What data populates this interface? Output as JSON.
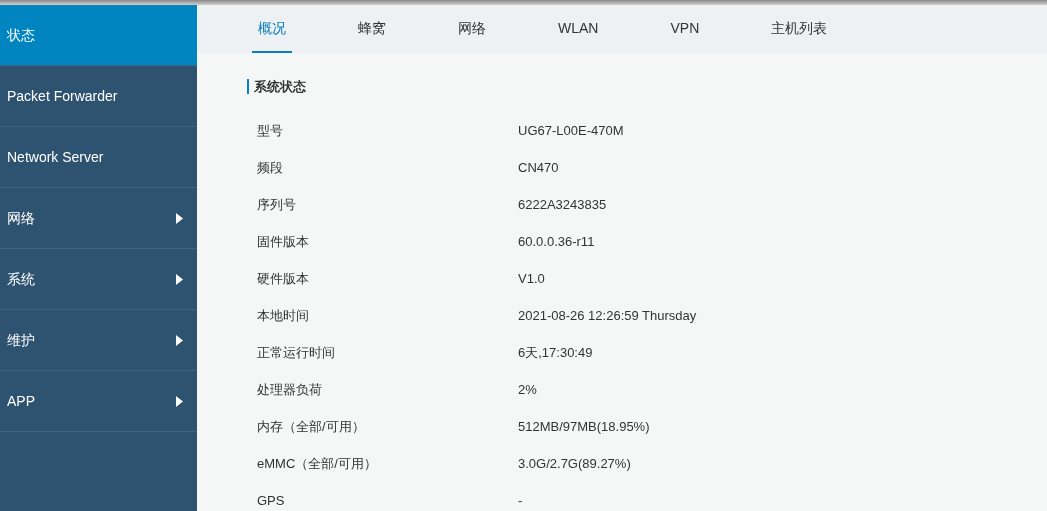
{
  "sidebar": {
    "items": [
      {
        "label": "状态",
        "selected": true,
        "expandable": false
      },
      {
        "label": "Packet Forwarder",
        "selected": false,
        "expandable": false
      },
      {
        "label": "Network Server",
        "selected": false,
        "expandable": false
      },
      {
        "label": "网络",
        "selected": false,
        "expandable": true
      },
      {
        "label": "系统",
        "selected": false,
        "expandable": true
      },
      {
        "label": "维护",
        "selected": false,
        "expandable": true
      },
      {
        "label": "APP",
        "selected": false,
        "expandable": true
      }
    ]
  },
  "tabs": [
    {
      "label": "概况",
      "selected": true
    },
    {
      "label": "蜂窝",
      "selected": false
    },
    {
      "label": "网络",
      "selected": false
    },
    {
      "label": "WLAN",
      "selected": false
    },
    {
      "label": "VPN",
      "selected": false
    },
    {
      "label": "主机列表",
      "selected": false
    }
  ],
  "section": {
    "title": "系统状态",
    "rows": [
      {
        "label": "型号",
        "value": "UG67-L00E-470M"
      },
      {
        "label": "频段",
        "value": "CN470"
      },
      {
        "label": "序列号",
        "value": "6222A3243835"
      },
      {
        "label": "固件版本",
        "value": "60.0.0.36-r11"
      },
      {
        "label": "硬件版本",
        "value": "V1.0"
      },
      {
        "label": "本地时间",
        "value": "2021-08-26 12:26:59 Thursday"
      },
      {
        "label": "正常运行时间",
        "value": "6天,17:30:49"
      },
      {
        "label": "处理器负荷",
        "value": "2%"
      },
      {
        "label": "内存（全部/可用）",
        "value": "512MB/97MB(18.95%)"
      },
      {
        "label": "eMMC（全部/可用）",
        "value": "3.0G/2.7G(89.27%)"
      },
      {
        "label": "GPS",
        "value": "-"
      }
    ]
  }
}
